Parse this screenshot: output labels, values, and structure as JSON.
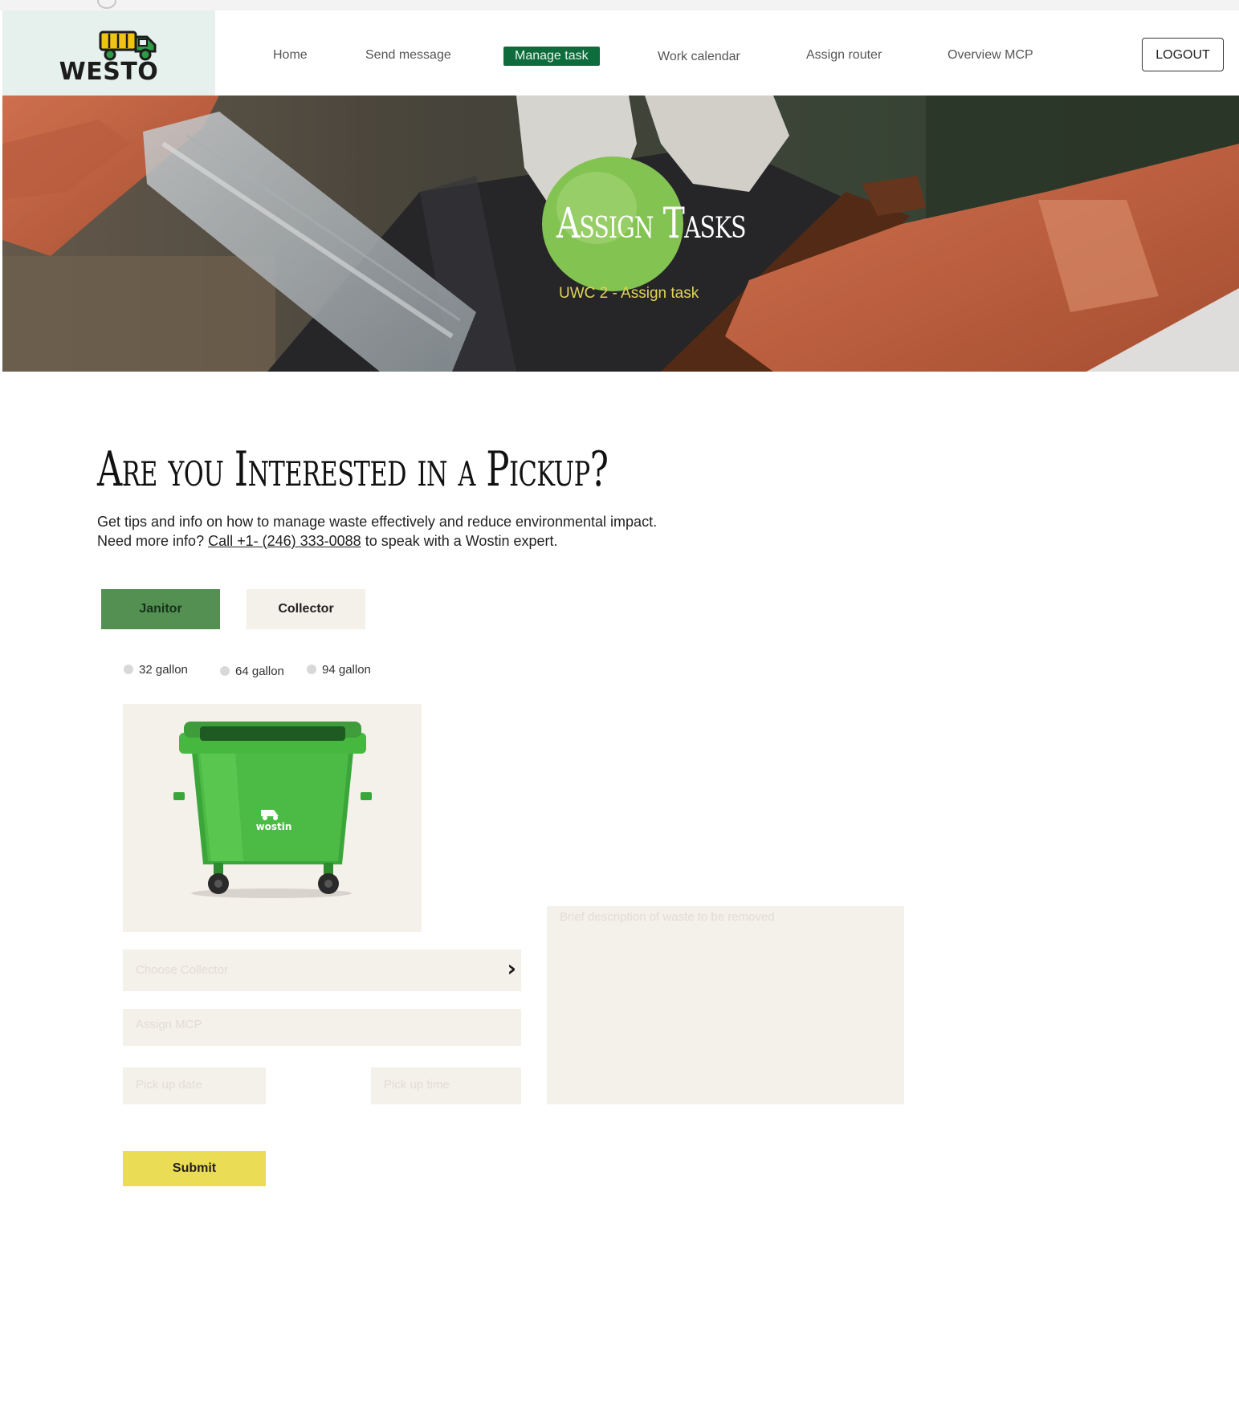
{
  "brand": {
    "name": "WESTO"
  },
  "nav": {
    "items": [
      {
        "label": "Home"
      },
      {
        "label": "Send message"
      },
      {
        "label": "Manage task"
      },
      {
        "label": "Work calendar"
      },
      {
        "label": "Assign router"
      },
      {
        "label": "Overview MCP"
      }
    ],
    "active": "Manage task",
    "logout_label": "LOGOUT"
  },
  "hero": {
    "title": "Assign Tasks",
    "subtitle": "UWC 2 - Assign task"
  },
  "main": {
    "heading": "Are you Interested in a Pickup?",
    "desc_line1": "Get tips and info on how to manage waste effectively and reduce environmental impact.",
    "desc_line2_prefix": "Need more info? ",
    "desc_link": "Call +1- (246) 333-0088",
    "desc_line2_suffix": " to speak with a Wostin expert."
  },
  "roles": {
    "janitor": "Janitor",
    "collector": "Collector",
    "selected": "Janitor"
  },
  "bin_sizes": [
    {
      "label": "32 gallon"
    },
    {
      "label": "64 gallon"
    },
    {
      "label": "94 gallon"
    }
  ],
  "bin_image": {
    "brand_text": "wostin"
  },
  "form": {
    "choose_collector_placeholder": "Choose Collector",
    "assign_mcp_placeholder": "Assign MCP",
    "pickup_date_placeholder": "Pick up date",
    "pickup_time_placeholder": "Pick up time",
    "description_placeholder": "Brief description of waste to be removed",
    "submit_label": "Submit"
  },
  "colors": {
    "nav_active_bg": "#0d6b3c",
    "janitor_tab_bg": "#559053",
    "submit_bg": "#ebdc55",
    "field_bg": "#f4f0ea",
    "logo_bg": "#e6f1ee",
    "hero_subtitle": "#e0d25a"
  }
}
